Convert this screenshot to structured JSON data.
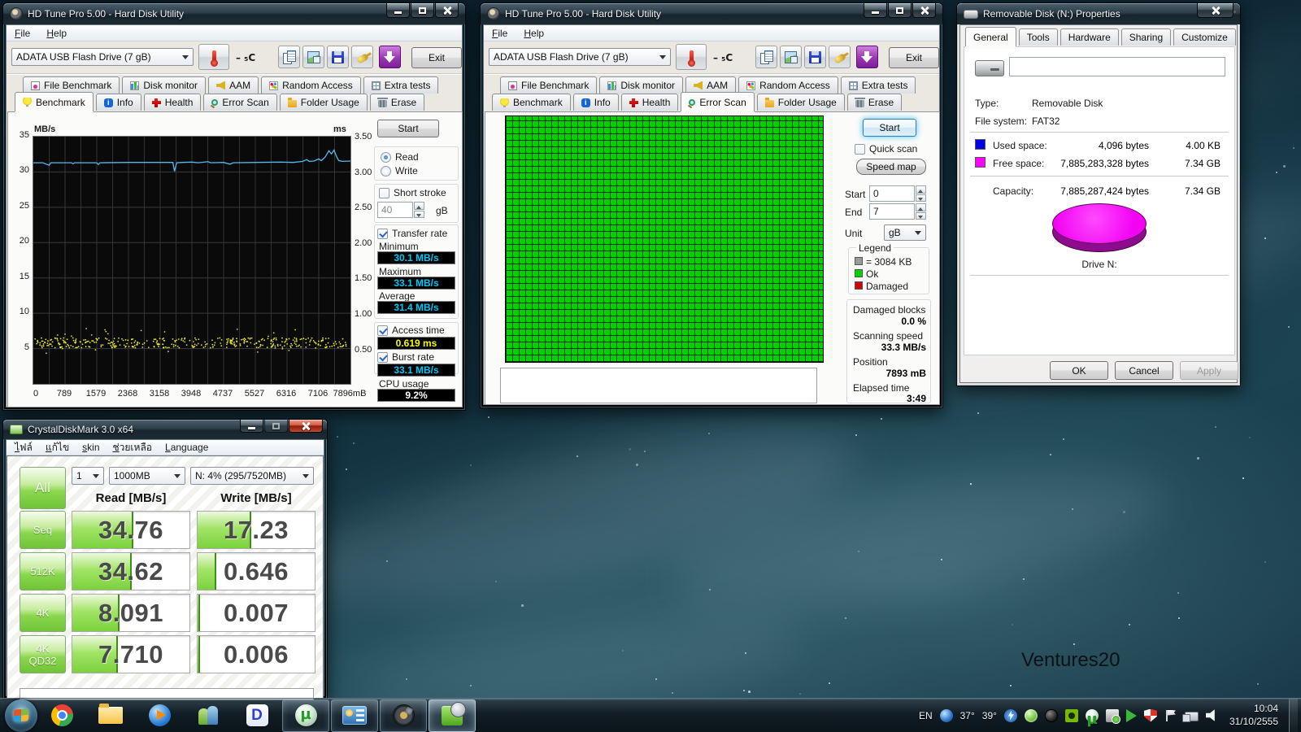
{
  "wallpaper": {
    "watermark": "Ventures20"
  },
  "hdtune_benchmark": {
    "title": "HD Tune Pro 5.00 - Hard Disk Utility",
    "menu": {
      "file": "File",
      "help": "Help"
    },
    "toolbar": {
      "drive": "ADATA  USB Flash Drive  (7 gB)",
      "temp": "– ₅C",
      "exit": "Exit"
    },
    "tabs_top": [
      {
        "label": "File Benchmark",
        "icon": "file-benchmark-icon"
      },
      {
        "label": "Disk monitor",
        "icon": "disk-monitor-icon"
      },
      {
        "label": "AAM",
        "icon": "aam-icon"
      },
      {
        "label": "Random Access",
        "icon": "random-access-icon"
      },
      {
        "label": "Extra tests",
        "icon": "extra-tests-icon"
      }
    ],
    "tabs_bottom": [
      {
        "label": "Benchmark",
        "icon": "benchmark-icon",
        "active": true
      },
      {
        "label": "Info",
        "icon": "info-icon"
      },
      {
        "label": "Health",
        "icon": "health-icon"
      },
      {
        "label": "Error Scan",
        "icon": "error-scan-icon"
      },
      {
        "label": "Folder Usage",
        "icon": "folder-usage-icon"
      },
      {
        "label": "Erase",
        "icon": "erase-icon"
      }
    ],
    "graph": {
      "y_left_unit": "MB/s",
      "y_right_unit": "ms",
      "y_left_ticks": [
        "35",
        "30",
        "25",
        "20",
        "15",
        "10",
        "5"
      ],
      "y_right_ticks": [
        "3.50",
        "3.00",
        "2.50",
        "2.00",
        "1.50",
        "1.00",
        "0.50"
      ],
      "x_ticks": [
        "0",
        "789",
        "1579",
        "2368",
        "3158",
        "3948",
        "4737",
        "5527",
        "6316",
        "7106"
      ],
      "x_end_label": "7896mB",
      "line_color": "#55b9ee",
      "dot_color": "#f8f83a",
      "transfer_line": [
        [
          0,
          31.3
        ],
        [
          0.03,
          31.3
        ],
        [
          0.05,
          30.95
        ],
        [
          0.055,
          31.3
        ],
        [
          0.12,
          31.3
        ],
        [
          0.125,
          31.15
        ],
        [
          0.13,
          31.3
        ],
        [
          0.2,
          31.3
        ],
        [
          0.205,
          31.05
        ],
        [
          0.21,
          31.3
        ],
        [
          0.3,
          31.35
        ],
        [
          0.44,
          31.35
        ],
        [
          0.445,
          30.1
        ],
        [
          0.452,
          31.3
        ],
        [
          0.47,
          31.35
        ],
        [
          0.5,
          31.4
        ],
        [
          0.52,
          31.3
        ],
        [
          0.55,
          31.45
        ],
        [
          0.56,
          31.3
        ],
        [
          0.6,
          31.35
        ],
        [
          0.62,
          31.1
        ],
        [
          0.63,
          31.3
        ],
        [
          0.7,
          31.35
        ],
        [
          0.78,
          31.4
        ],
        [
          0.82,
          31.35
        ],
        [
          0.85,
          31.5
        ],
        [
          0.862,
          31.75
        ],
        [
          0.87,
          31.5
        ],
        [
          0.885,
          31.55
        ],
        [
          0.9,
          31.85
        ],
        [
          0.908,
          31.6
        ],
        [
          0.92,
          32.1
        ],
        [
          0.932,
          33.0
        ],
        [
          0.94,
          32.55
        ],
        [
          0.948,
          33.1
        ],
        [
          0.956,
          32.2
        ],
        [
          0.963,
          31.6
        ],
        [
          0.975,
          31.5
        ],
        [
          1,
          31.55
        ]
      ],
      "access_band": {
        "ms_center": 0.62,
        "ms_spread": 0.14,
        "count": 400
      }
    },
    "panel": {
      "start": "Start",
      "read": "Read",
      "write": "Write",
      "short_stroke": "Short stroke",
      "stroke_value": "40",
      "stroke_unit": "gB",
      "transfer_rate": "Transfer rate",
      "minimum_label": "Minimum",
      "minimum": "30.1 MB/s",
      "maximum_label": "Maximum",
      "maximum": "33.1 MB/s",
      "average_label": "Average",
      "average": "31.4 MB/s",
      "access_label": "Access time",
      "access": "0.619 ms",
      "burst_label": "Burst rate",
      "burst": "33.1 MB/s",
      "cpu_label": "CPU usage",
      "cpu": "9.2%"
    }
  },
  "hdtune_errorscan": {
    "title": "HD Tune Pro 5.00 - Hard Disk Utility",
    "menu": {
      "file": "File",
      "help": "Help"
    },
    "toolbar": {
      "drive": "ADATA  USB Flash Drive  (7 gB)",
      "temp": "– ₅C",
      "exit": "Exit"
    },
    "tabs_top": [
      {
        "label": "File Benchmark",
        "icon": "file-benchmark-icon"
      },
      {
        "label": "Disk monitor",
        "icon": "disk-monitor-icon"
      },
      {
        "label": "AAM",
        "icon": "aam-icon"
      },
      {
        "label": "Random Access",
        "icon": "random-access-icon"
      },
      {
        "label": "Extra tests",
        "icon": "extra-tests-icon"
      }
    ],
    "tabs_bottom": [
      {
        "label": "Benchmark",
        "icon": "benchmark-icon"
      },
      {
        "label": "Info",
        "icon": "info-icon"
      },
      {
        "label": "Health",
        "icon": "health-icon"
      },
      {
        "label": "Error Scan",
        "icon": "error-scan-icon",
        "active": true
      },
      {
        "label": "Folder Usage",
        "icon": "folder-usage-icon"
      },
      {
        "label": "Erase",
        "icon": "erase-icon"
      }
    ],
    "scan_grid": {
      "columns": 49,
      "rows": 38,
      "block_color_ok": "#00d400"
    },
    "panel": {
      "start": "Start",
      "quick_scan": "Quick scan",
      "speed_map": "Speed map",
      "start_label": "Start",
      "start_value": "0",
      "end_label": "End",
      "end_value": "7",
      "unit_label": "Unit",
      "unit_value": "gB",
      "legend_title": "Legend",
      "legend_block": "= 3084 KB",
      "legend_ok": "Ok",
      "legend_damaged": "Damaged",
      "damaged_label": "Damaged blocks",
      "damaged_value": "0.0 %",
      "speed_label": "Scanning speed",
      "speed_value": "33.3 MB/s",
      "position_label": "Position",
      "position_value": "7893 mB",
      "elapsed_label": "Elapsed time",
      "elapsed_value": "3:49"
    }
  },
  "properties": {
    "title": "Removable Disk (N:) Properties",
    "tabs": [
      {
        "label": "General",
        "active": true
      },
      {
        "label": "Tools"
      },
      {
        "label": "Hardware"
      },
      {
        "label": "Sharing"
      },
      {
        "label": "Customize"
      }
    ],
    "fields": {
      "type_label": "Type:",
      "type_value": "Removable Disk",
      "fs_label": "File system:",
      "fs_value": "FAT32",
      "used_label": "Used space:",
      "used_bytes": "4,096 bytes",
      "used_size": "4.00 KB",
      "free_label": "Free space:",
      "free_bytes": "7,885,283,328 bytes",
      "free_size": "7.34 GB",
      "capacity_label": "Capacity:",
      "capacity_bytes": "7,885,287,424 bytes",
      "capacity_size": "7.34 GB",
      "drive_label": "Drive N:"
    },
    "colors": {
      "used": "#0000e8",
      "free": "#ff00ff",
      "pie_top": "#f203f2",
      "pie_side": "#8e0b8e"
    },
    "buttons": {
      "ok": "OK",
      "cancel": "Cancel",
      "apply": "Apply"
    }
  },
  "cdm": {
    "title": "CrystalDiskMark 3.0 x64",
    "menu": [
      {
        "label": "ไฟล์"
      },
      {
        "label": "แก้ไข"
      },
      {
        "label": "skin"
      },
      {
        "label": "ช่วยเหลือ"
      },
      {
        "label": "Language"
      }
    ],
    "controls": {
      "test_count": "1",
      "test_size": "1000MB",
      "target": "N: 4% (295/7520MB)"
    },
    "all_button": "All",
    "read_header": "Read [MB/s]",
    "write_header": "Write [MB/s]",
    "rows": [
      {
        "label": "Seq",
        "read": "34.76",
        "write": "17.23",
        "read_fill": 52,
        "write_fill": 46
      },
      {
        "label": "512K",
        "read": "34.62",
        "write": "0.646",
        "read_fill": 51,
        "write_fill": 16
      },
      {
        "label": "4K",
        "read": "8.091",
        "write": "0.007",
        "read_fill": 40,
        "write_fill": 2
      },
      {
        "label": "4K\nQD32",
        "read": "7.710",
        "write": "0.006",
        "read_fill": 39,
        "write_fill": 2
      }
    ]
  },
  "taskbar": {
    "tray": {
      "lang": "EN",
      "temp1": "37°",
      "temp2": "39°",
      "time": "10:04",
      "date": "31/10/2555"
    }
  }
}
